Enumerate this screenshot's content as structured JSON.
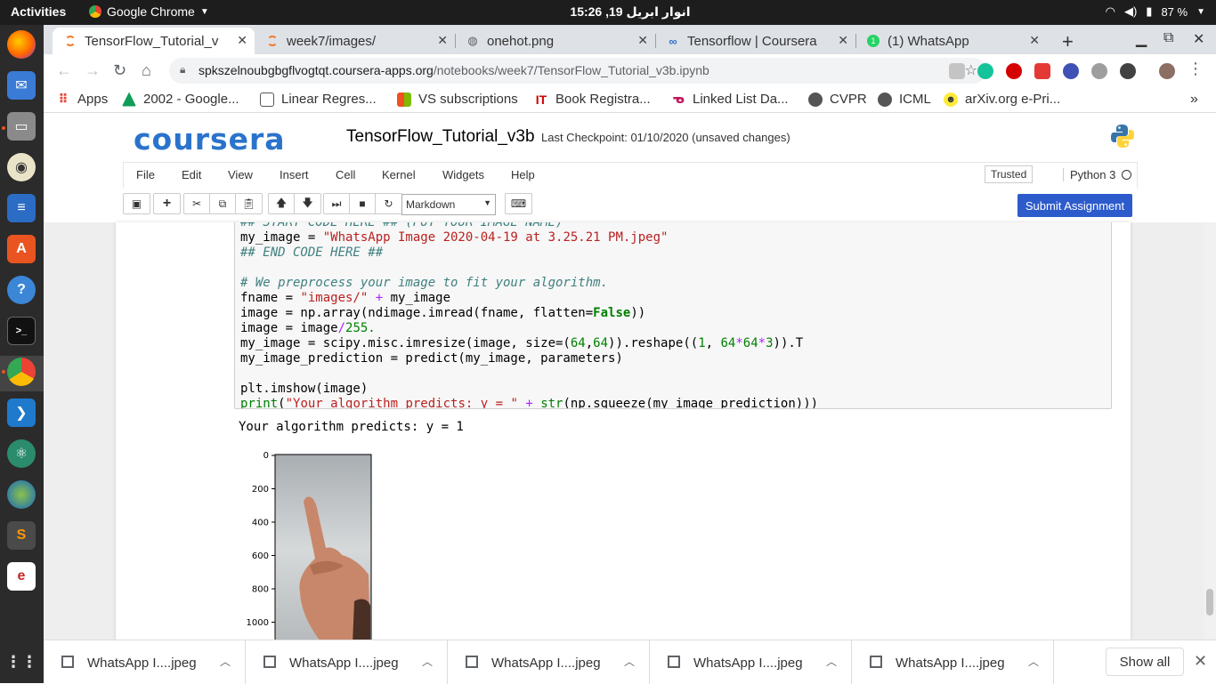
{
  "topbar": {
    "activities": "Activities",
    "app_name": "Google Chrome",
    "clock": "انوار ابریل 19, 15:26",
    "battery": "87 %"
  },
  "tabs": [
    {
      "title": "TensorFlow_Tutorial_v",
      "active": true
    },
    {
      "title": "week7/images/",
      "active": false
    },
    {
      "title": "onehot.png",
      "active": false
    },
    {
      "title": "Tensorflow | Coursera",
      "active": false
    },
    {
      "title": "(1) WhatsApp",
      "active": false
    }
  ],
  "omnibox": {
    "host": "spkszelnoubgbgflvogtqt.coursera-apps.org",
    "path": "/notebooks/week7/TensorFlow_Tutorial_v3b.ipynb"
  },
  "bookmarks": [
    {
      "label": "Apps",
      "color": "#e94235"
    },
    {
      "label": "2002 - Google...",
      "color": "#0f9d58"
    },
    {
      "label": "Linear Regres...",
      "color": "#555555"
    },
    {
      "label": "VS subscriptions",
      "color": "#f25022"
    },
    {
      "label": "Book Registra...",
      "color": "#cc0000"
    },
    {
      "label": "Linked List Da...",
      "color": "#c2185b"
    },
    {
      "label": "CVPR",
      "color": "#555555"
    },
    {
      "label": "ICML",
      "color": "#555555"
    },
    {
      "label": "arXiv.org e-Pri...",
      "color": "#6aaa1e"
    }
  ],
  "notebook": {
    "brand": "coursera",
    "title": "TensorFlow_Tutorial_v3b",
    "checkpoint": "Last Checkpoint: 01/10/2020 (unsaved changes)",
    "menus": [
      "File",
      "Edit",
      "View",
      "Insert",
      "Cell",
      "Kernel",
      "Widgets",
      "Help"
    ],
    "trusted": "Trusted",
    "kernel": "Python 3",
    "cell_type": "Markdown",
    "submit": "Submit Assignment"
  },
  "code_lines": [
    "## START CODE HERE ## (PUT YOUR IMAGE NAME)",
    "my_image = \"WhatsApp Image 2020-04-19 at 3.25.21 PM.jpeg\"",
    "## END CODE HERE ##",
    "",
    "# We preprocess your image to fit your algorithm.",
    "fname = \"images/\" + my_image",
    "image = np.array(ndimage.imread(fname, flatten=False))",
    "image = image/255.",
    "my_image = scipy.misc.imresize(image, size=(64,64)).reshape((1, 64*64*3)).T",
    "my_image_prediction = predict(my_image, parameters)",
    "",
    "plt.imshow(image)",
    "print(\"Your algorithm predicts: y = \" + str(np.squeeze(my_image_prediction)))"
  ],
  "output_text": "Your algorithm predicts: y = 1",
  "plot_ticks": [
    "0",
    "200",
    "400",
    "600",
    "800",
    "1000"
  ],
  "downloads": [
    {
      "name": "WhatsApp I....jpeg"
    },
    {
      "name": "WhatsApp I....jpeg"
    },
    {
      "name": "WhatsApp I....jpeg"
    },
    {
      "name": "WhatsApp I....jpeg"
    },
    {
      "name": "WhatsApp I....jpeg"
    }
  ],
  "show_all": "Show all"
}
